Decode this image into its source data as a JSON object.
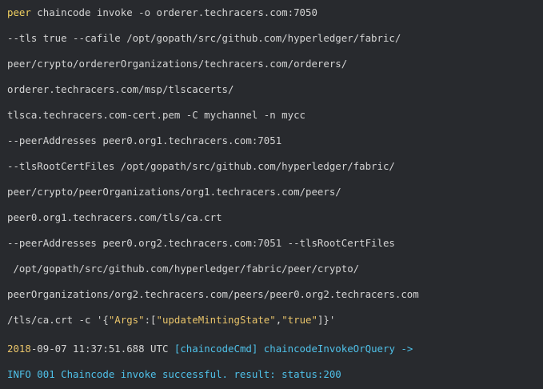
{
  "terminal": {
    "lines": [
      {
        "parts": [
          {
            "t": "peer",
            "c": "kw"
          },
          {
            "t": " chaincode invoke -o orderer.techracers.com:7050",
            "c": ""
          }
        ]
      },
      {
        "parts": [
          {
            "t": "--tls true --cafile /opt/gopath/src/github.com/hyperledger/fabric/",
            "c": ""
          }
        ]
      },
      {
        "parts": [
          {
            "t": "peer/crypto/ordererOrganizations/techracers.com/orderers/",
            "c": ""
          }
        ]
      },
      {
        "parts": [
          {
            "t": "orderer.techracers.com/msp/tlscacerts/",
            "c": ""
          }
        ]
      },
      {
        "parts": [
          {
            "t": "tlsca.techracers.com-cert.pem -C mychannel -n mycc",
            "c": ""
          }
        ]
      },
      {
        "parts": [
          {
            "t": "--peerAddresses peer0.org1.techracers.com:7051",
            "c": ""
          }
        ]
      },
      {
        "parts": [
          {
            "t": "--tlsRootCertFiles /opt/gopath/src/github.com/hyperledger/fabric/",
            "c": ""
          }
        ]
      },
      {
        "parts": [
          {
            "t": "peer/crypto/peerOrganizations/org1.techracers.com/peers/",
            "c": ""
          }
        ]
      },
      {
        "parts": [
          {
            "t": "peer0.org1.techracers.com/tls/ca.crt",
            "c": ""
          }
        ]
      },
      {
        "parts": [
          {
            "t": "--peerAddresses peer0.org2.techracers.com:7051 --tlsRootCertFiles",
            "c": ""
          }
        ]
      },
      {
        "parts": [
          {
            "t": " /opt/gopath/src/github.com/hyperledger/fabric/peer/crypto/",
            "c": ""
          }
        ]
      },
      {
        "parts": [
          {
            "t": "peerOrganizations/org2.techracers.com/peers/peer0.org2.techracers.com",
            "c": ""
          }
        ]
      },
      {
        "parts": [
          {
            "t": "/tls/ca.crt -c '{",
            "c": ""
          },
          {
            "t": "\"Args\"",
            "c": "yellow"
          },
          {
            "t": ":[",
            "c": ""
          },
          {
            "t": "\"updateMintingState\"",
            "c": "yellow"
          },
          {
            "t": ",",
            "c": ""
          },
          {
            "t": "\"true\"",
            "c": "yellow"
          },
          {
            "t": "]}'",
            "c": ""
          }
        ]
      },
      {
        "parts": [
          {
            "t": "2018",
            "c": "yellow"
          },
          {
            "t": "-09-07 11:37:51.688 UTC ",
            "c": ""
          },
          {
            "t": "[chaincodeCmd] chaincodeInvokeOrQuery ->",
            "c": "cyan"
          }
        ]
      },
      {
        "parts": [
          {
            "t": "INFO 001 Chaincode invoke successful. result: status:200",
            "c": "cyan"
          }
        ]
      }
    ]
  },
  "colors": {
    "background": "#282a2e",
    "text": "#d4d4d4",
    "keyword": "#f0d060",
    "string": "#e9c46a",
    "info": "#4fc1e9"
  }
}
